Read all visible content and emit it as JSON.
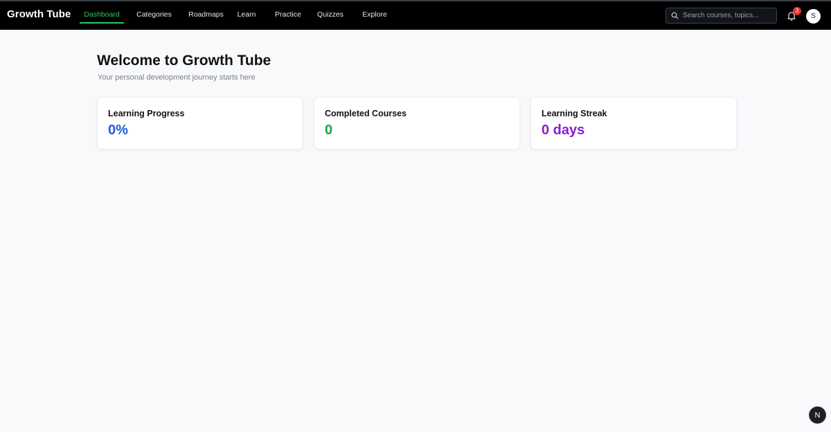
{
  "app": {
    "brand": "Growth Tube"
  },
  "nav": {
    "items": [
      {
        "label": "Dashboard",
        "active": true
      },
      {
        "label": "Categories",
        "active": false
      },
      {
        "label": "Roadmaps",
        "active": false
      },
      {
        "label": "Learn",
        "active": false
      },
      {
        "label": "Practice",
        "active": false
      },
      {
        "label": "Quizzes",
        "active": false
      },
      {
        "label": "Explore",
        "active": false
      }
    ]
  },
  "search": {
    "placeholder": "Search courses, topics..."
  },
  "notifications": {
    "count": "3"
  },
  "user": {
    "initial": "S"
  },
  "main": {
    "title": "Welcome to Growth Tube",
    "subtitle": "Your personal development journey starts here"
  },
  "stats": [
    {
      "label": "Learning Progress",
      "value": "0%",
      "color": "#1d5fd6"
    },
    {
      "label": "Completed Courses",
      "value": "0",
      "color": "#18a34a"
    },
    {
      "label": "Learning Streak",
      "value": "0 days",
      "color": "#8a1cd4"
    }
  ],
  "dev_indicator": {
    "label": "N"
  },
  "colors": {
    "accent": "#2ecc55",
    "topbar": "#000000",
    "page_bg": "#f8f9fb"
  }
}
